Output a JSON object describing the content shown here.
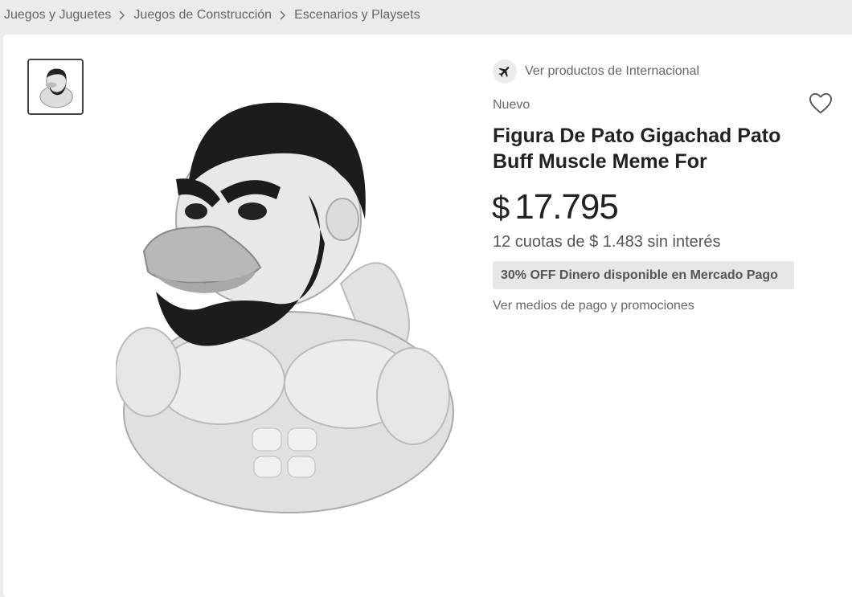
{
  "breadcrumb": {
    "items": [
      {
        "label": "Juegos y Juguetes"
      },
      {
        "label": "Juegos de Construcción"
      },
      {
        "label": "Escenarios y Playsets"
      }
    ]
  },
  "gallery": {
    "main_image": "gigachad-duck-figure",
    "thumbnails": [
      "gigachad-duck-figure"
    ]
  },
  "seller": {
    "icon": "airplane-icon",
    "label": "Ver productos de Internacional"
  },
  "product": {
    "condition": "Nuevo",
    "title": "Figura De Pato Gigachad Pato Buff Muscle Meme For",
    "favorite_icon": "heart-outline-icon"
  },
  "price": {
    "currency": "$",
    "amount": "17.795"
  },
  "installments": {
    "text": "12 cuotas de $ 1.483 sin interés"
  },
  "promo": {
    "text": "30% OFF Dinero disponible en Mercado Pago"
  },
  "payment": {
    "link_label": "Ver medios de pago y promociones"
  },
  "colors": {
    "page_background": "#ebebeb",
    "card_background": "#ffffff",
    "badge_background": "#e6e6e6",
    "text_primary": "#222222",
    "text_secondary": "#666666"
  }
}
